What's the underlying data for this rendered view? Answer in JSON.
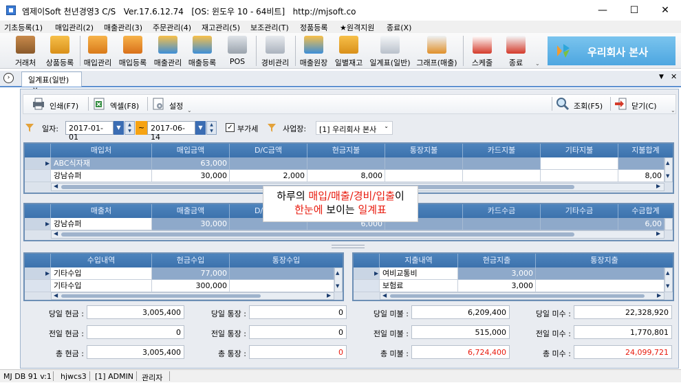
{
  "window": {
    "title": "엠제이Soft 천년경영3 C/S   Ver.17.6.12.74   [OS: 윈도우 10 - 64비트]   http://mjsoft.co",
    "minimize": "—",
    "maximize": "☐",
    "close": "✕"
  },
  "menu": [
    "기초등록(1)",
    "매입관리(2)",
    "매출관리(3)",
    "주문관리(4)",
    "재고관리(5)",
    "보조관리(T)",
    "정품등록",
    "★원격지원",
    "종료(X)"
  ],
  "toolbar": [
    {
      "label": "거래처",
      "icon": "person-icon"
    },
    {
      "label": "상품등록",
      "icon": "boxes-icon"
    },
    {
      "label": "매입관리",
      "icon": "purchase-icon"
    },
    {
      "label": "매입등록",
      "icon": "purchase-add-icon"
    },
    {
      "label": "매출관리",
      "icon": "sales-icon"
    },
    {
      "label": "매출등록",
      "icon": "sales-add-icon"
    },
    {
      "label": "POS",
      "icon": "pos-icon"
    },
    {
      "label": "경비관리",
      "icon": "expense-icon"
    },
    {
      "label": "매출원장",
      "icon": "ledger-icon"
    },
    {
      "label": "일별재고",
      "icon": "calendar-stock-icon"
    },
    {
      "label": "일계표(일반)",
      "icon": "daily-report-icon"
    },
    {
      "label": "그래프(매출)",
      "icon": "bar-graph-icon"
    },
    {
      "label": "스케줄",
      "icon": "calendar-icon"
    },
    {
      "label": "종료",
      "icon": "exit-icon"
    }
  ],
  "brand": {
    "text": "우리회사 본사"
  },
  "tab": {
    "label": "일계표(일반)",
    "close": "✕"
  },
  "content_toolbar": {
    "print": "인쇄(F7)",
    "excel": "엑셀(F8)",
    "settings": "설정",
    "search": "조회(F5)",
    "close": "닫기(C)"
  },
  "filter": {
    "date_label": "일자:",
    "date_from": "2017-01-01",
    "tilde": "~",
    "date_to": "2017-06-14",
    "vat_label": "부가세",
    "vat_checked": true,
    "business_label": "사업장:",
    "business_value": "[1] 우리회사 본사"
  },
  "purchase_grid": {
    "headers": [
      "매입처",
      "매입금액",
      "D/C금액",
      "현금지불",
      "통장지불",
      "카드지불",
      "기타지불",
      "지불합계"
    ],
    "rows": [
      [
        "ABC식자재",
        "63,000",
        "",
        "",
        "",
        "",
        "",
        ""
      ],
      [
        "강남슈퍼",
        "30,000",
        "2,000",
        "8,000",
        "",
        "",
        "",
        "8,00"
      ]
    ]
  },
  "sales_grid": {
    "headers": [
      "매출처",
      "매출금액",
      "D/C금액",
      "",
      "",
      "카드수금",
      "기타수금",
      "수금합계"
    ],
    "rows": [
      [
        "강남슈퍼",
        "30,000",
        "",
        "6,000",
        "",
        "",
        "",
        "6,00"
      ]
    ]
  },
  "income_grid": {
    "headers": [
      "수입내역",
      "현금수입",
      "통장수입"
    ],
    "rows": [
      [
        "기타수입",
        "77,000",
        ""
      ],
      [
        "기타수입",
        "300,000",
        ""
      ]
    ]
  },
  "expense_grid": {
    "headers": [
      "지출내역",
      "현금지출",
      "통장지출"
    ],
    "rows": [
      [
        "여비교통비",
        "3,000",
        ""
      ],
      [
        "보험료",
        "3,000",
        ""
      ]
    ]
  },
  "summary": {
    "today_cash": {
      "label": "당일 현금 :",
      "value": "3,005,400"
    },
    "prev_cash": {
      "label": "전일 현금 :",
      "value": "0"
    },
    "total_cash": {
      "label": "총 현금 :",
      "value": "3,005,400"
    },
    "today_bank": {
      "label": "당일 통장 :",
      "value": "0"
    },
    "prev_bank": {
      "label": "전일 통장 :",
      "value": "0"
    },
    "total_bank": {
      "label": "총 통장 :",
      "value": "0"
    },
    "today_unpaid": {
      "label": "당일 미불 :",
      "value": "6,209,400"
    },
    "prev_unpaid": {
      "label": "전일 미불 :",
      "value": "515,000"
    },
    "total_unpaid": {
      "label": "총 미불 :",
      "value": "6,724,400"
    },
    "today_receivable": {
      "label": "당일 미수 :",
      "value": "22,328,920"
    },
    "prev_receivable": {
      "label": "전일 미수 :",
      "value": "1,770,801"
    },
    "total_receivable": {
      "label": "총 미수 :",
      "value": "24,099,721"
    }
  },
  "tooltip": {
    "line1_pre": "하루의 ",
    "line1_red": "매입/매출/경비/입출",
    "line1_post": "이",
    "line2_red1": "한눈에",
    "line2_mid": " 보이는 ",
    "line2_red2": "일계표"
  },
  "status": [
    "MJ DB 91 v:1",
    "hjwcs3",
    "[1] ADMIN",
    "관리자"
  ],
  "colors": {
    "accent": "#3c72ad",
    "brand": "#4da6e0",
    "warning": "#e8190c"
  }
}
